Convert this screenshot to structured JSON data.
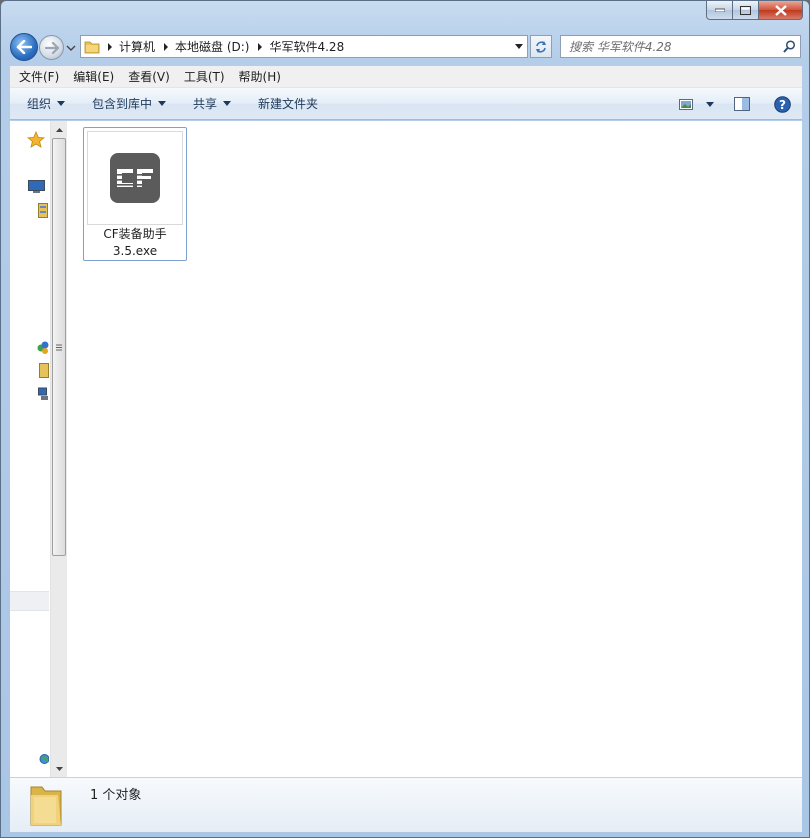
{
  "window": {
    "caption_buttons": [
      "minimize",
      "maximize",
      "close"
    ]
  },
  "navigation": {
    "breadcrumbs": [
      "计算机",
      "本地磁盘 (D:)",
      "华军软件4.28"
    ],
    "search_placeholder": "搜索 华军软件4.28"
  },
  "menubar": {
    "items": [
      "文件(F)",
      "编辑(E)",
      "查看(V)",
      "工具(T)",
      "帮助(H)"
    ]
  },
  "commandbar": {
    "organize": "组织",
    "include_in_library": "包含到库中",
    "share": "共享",
    "new_folder": "新建文件夹",
    "right_icons": [
      "view-options-icon",
      "preview-pane-icon",
      "help-icon"
    ]
  },
  "navpane": {
    "icons": [
      "favorites-star-icon",
      "desktop-icon",
      "libraries-icon",
      "homegroup-icon",
      "computer-icon",
      "network-icon",
      "globe-icon"
    ]
  },
  "files": [
    {
      "name_line1": "CF装备助手",
      "name_line2": "3.5.exe",
      "icon": "cf-app-icon"
    }
  ],
  "details": {
    "summary": "1 个对象"
  },
  "colors": {
    "selection_border": "#7da2ce",
    "cf_icon_bg": "#5b5b5b"
  }
}
